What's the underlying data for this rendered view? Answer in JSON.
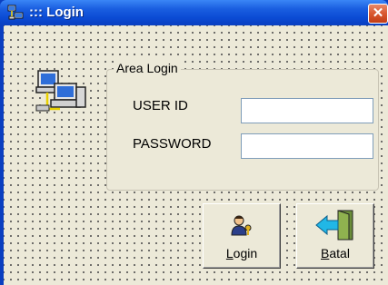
{
  "window": {
    "title": "::: Login",
    "close_glyph": "✕"
  },
  "group": {
    "legend": "Area Login"
  },
  "fields": {
    "userid": {
      "label": "USER ID",
      "value": ""
    },
    "password": {
      "label": "PASSWORD",
      "value": ""
    }
  },
  "buttons": {
    "login": {
      "label_mnemonic": "L",
      "label_rest": "ogin"
    },
    "batal": {
      "label_mnemonic": "B",
      "label_rest": "atal"
    }
  },
  "icons": {
    "title": "network-computers-icon",
    "side": "network-computers-icon",
    "login": "person-key-icon",
    "batal": "exit-door-icon"
  },
  "colors": {
    "titlebar": "#0b4bd4",
    "close": "#d9582f",
    "face": "#ece9d8"
  }
}
